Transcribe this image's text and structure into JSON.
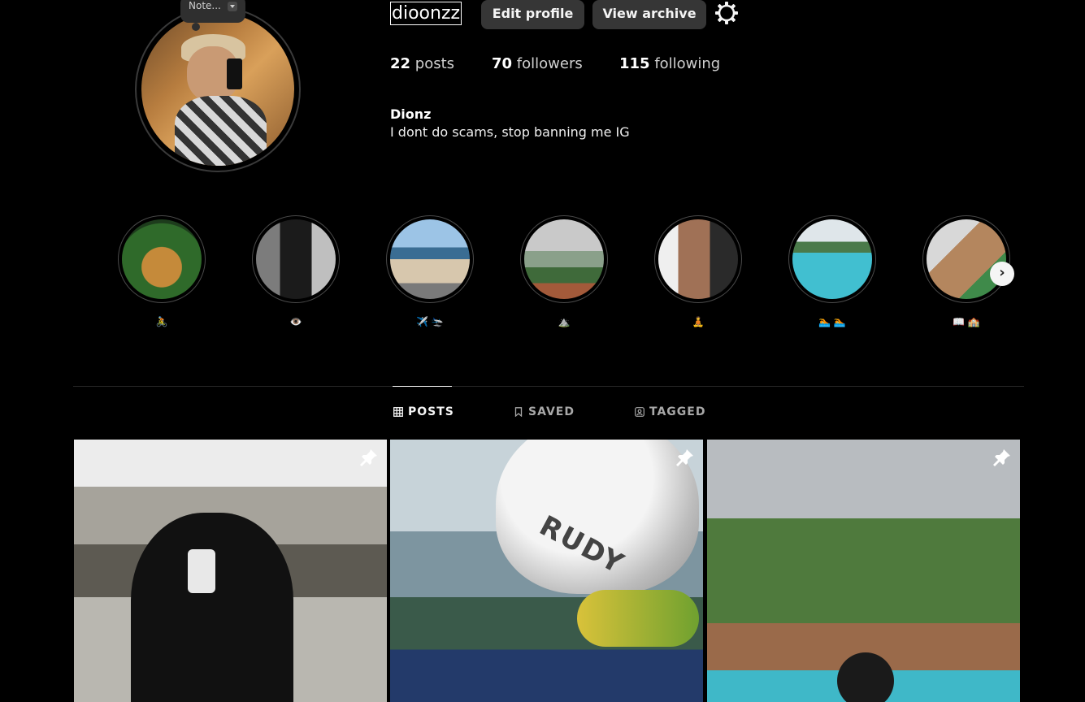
{
  "note": {
    "text": "Note..."
  },
  "profile": {
    "username": "dioonzz",
    "edit_label": "Edit profile",
    "archive_label": "View archive",
    "stats": {
      "posts_count": "22",
      "posts_label": "posts",
      "followers_count": "70",
      "followers_label": "followers",
      "following_count": "115",
      "following_label": "following"
    },
    "full_name": "Dionz",
    "bio": "I dont do scams, stop banning me IG"
  },
  "highlights": [
    {
      "label": "🚴"
    },
    {
      "label": "👁️"
    },
    {
      "label": "✈️ 🛬"
    },
    {
      "label": "⛰️"
    },
    {
      "label": "🧘"
    },
    {
      "label": "🏊 🏊"
    },
    {
      "label": "📖 🏫"
    }
  ],
  "tabs": {
    "posts": "POSTS",
    "saved": "SAVED",
    "tagged": "TAGGED"
  },
  "posts": [
    {
      "pinned": true
    },
    {
      "pinned": true,
      "helmet_text": "RUDY"
    },
    {
      "pinned": true
    }
  ],
  "icons": {
    "settings": "gear-icon",
    "pin": "pin-icon",
    "next": "chevron-right-icon"
  }
}
